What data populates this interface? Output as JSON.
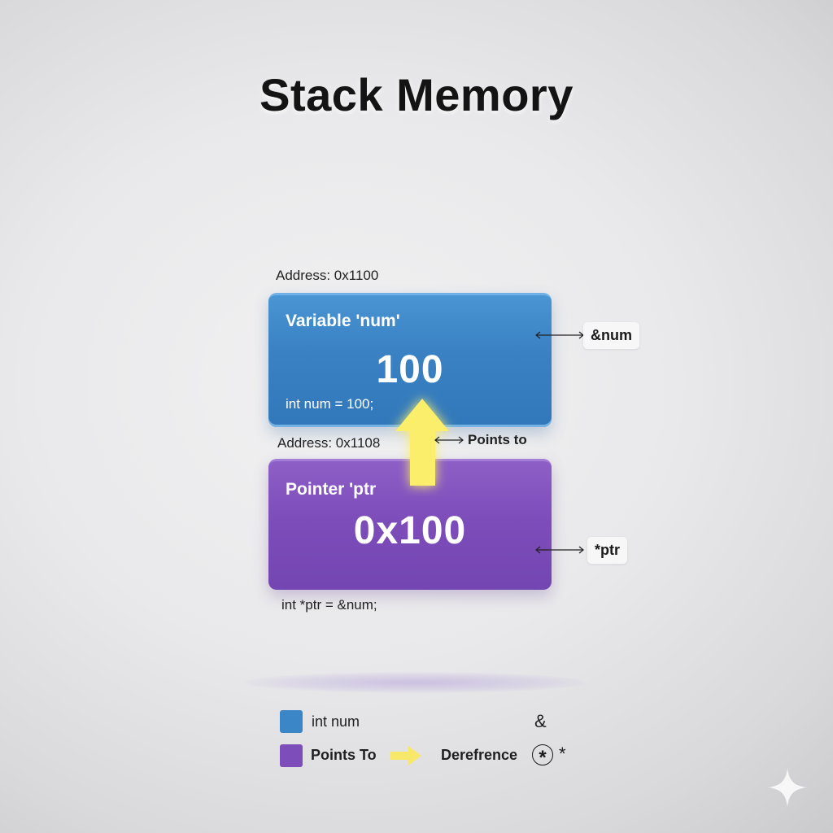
{
  "title": "Stack Memory",
  "variable": {
    "address": "Address: 0x1100",
    "label": "Variable 'num'",
    "value": "100",
    "code": "int num = 100;",
    "ref_tag": "&num",
    "color": "#3a82c4"
  },
  "pointer": {
    "address": "Address: 0x1108",
    "label": "Pointer 'ptr",
    "value": "0x100",
    "code": "int *ptr = &num;",
    "deref_tag": "*ptr",
    "color": "#7d4dba"
  },
  "arrow": {
    "label": "Points to",
    "color": "#fbee6a"
  },
  "legend": {
    "int_num": "int num",
    "points_to": "Points To",
    "dereference": "Derefrence",
    "ampersand": "&",
    "star": "*",
    "circled_star": "*"
  },
  "icons": [
    "up-arrow-icon",
    "double-arrow-icon",
    "circled-star-icon",
    "sparkle-icon"
  ]
}
